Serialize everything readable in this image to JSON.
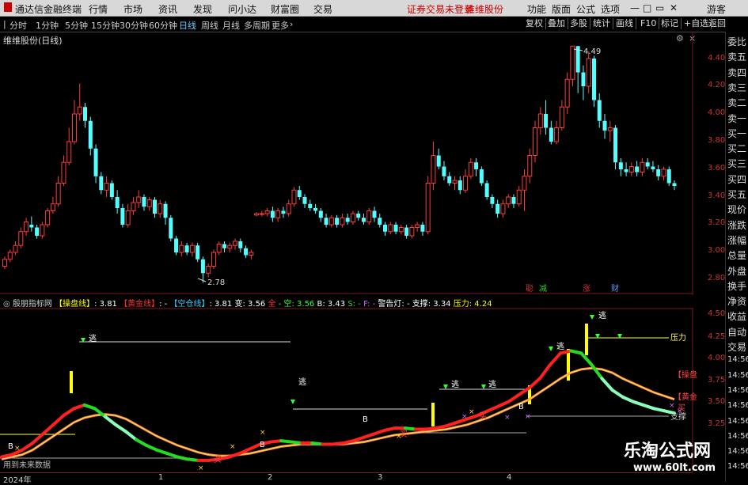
{
  "app": {
    "title": "通达信金融终端"
  },
  "menu": {
    "items": [
      "行情",
      "市场",
      "资讯",
      "发现",
      "问小达",
      "财富圈",
      "交易"
    ],
    "notice": "证券交易未登录",
    "stock_name": "维维股份",
    "right": [
      "功能",
      "版面",
      "公式",
      "选项"
    ],
    "user": "游客"
  },
  "toolbar": {
    "periods": [
      "分时",
      "1分钟",
      "5分钟",
      "15分钟",
      "30分钟",
      "60分钟",
      "日线",
      "周线",
      "月线",
      "多周期",
      "更多"
    ],
    "active_period": "日线",
    "buttons": [
      "复权",
      "叠加",
      "多股",
      "统计",
      "画线",
      "F10",
      "标记",
      "+自选",
      "返回"
    ]
  },
  "main_chart": {
    "title": "维维股份(日线)",
    "high_label": "4.49",
    "low_label": "2.78",
    "y_ticks": [
      "4.40",
      "4.20",
      "4.00",
      "3.80",
      "3.60",
      "3.40",
      "3.20",
      "3.00",
      "2.80"
    ],
    "event_tags": [
      {
        "text": "聪",
        "color": "#cc3333"
      },
      {
        "text": "减",
        "color": "#33cc33"
      },
      {
        "text": "涨",
        "color": "#cc3333"
      },
      {
        "text": "财",
        "color": "#6699ff"
      }
    ]
  },
  "indicator": {
    "name": "殷朋指标网",
    "legend": [
      {
        "label": "【操盘线】",
        "color": "#ffff00"
      },
      {
        "label": ": 3.81",
        "color": "#ffffff"
      },
      {
        "label": "【黄金线】",
        "color": "#ff3333"
      },
      {
        "label": ": -",
        "color": "#ffffff"
      },
      {
        "label": "【空仓线】",
        "color": "#33ccff"
      },
      {
        "label": ": 3.81",
        "color": "#ffffff"
      },
      {
        "label": "变: 3.56",
        "color": "#ffffff"
      },
      {
        "label": "全",
        "color": "#ff3333"
      },
      {
        "label": "- 空: 3.56",
        "color": "#33ff33"
      },
      {
        "label": "B: 3.43",
        "color": "#ffffff"
      },
      {
        "label": "S: -",
        "color": "#33cc33"
      },
      {
        "label": "F: -",
        "color": "#cc66ff"
      },
      {
        "label": "警告灯: -",
        "color": "#ffffff"
      },
      {
        "label": "支撑: 3.34",
        "color": "#ffffff"
      },
      {
        "label": "压力: 4.24",
        "color": "#ffff00"
      }
    ],
    "y_ticks": [
      "4.50",
      "4.25",
      "4.00",
      "3.75",
      "3.50",
      "3.25"
    ],
    "right_labels": [
      {
        "text": "压力",
        "color": "#ffff66"
      },
      {
        "text": "【操盘",
        "color": "#ff4444"
      },
      {
        "text": "【黄金",
        "color": "#ff4444"
      },
      {
        "text": "买",
        "color": "#ff4444"
      },
      {
        "text": "支撑",
        "color": "#cccccc"
      }
    ],
    "escape_label": "逃",
    "buy_label": "买",
    "b_label": "B",
    "footer_note": "用到未来数据"
  },
  "time_axis": {
    "labels": [
      "2024年",
      "1",
      "2",
      "3",
      "4"
    ]
  },
  "right_panel": {
    "items": [
      "委比",
      "卖五",
      "卖四",
      "卖三",
      "卖二",
      "卖一",
      "买一",
      "买二",
      "买三",
      "买四",
      "买五",
      "现价",
      "涨跌",
      "涨幅",
      "总量",
      "外盘",
      "换手",
      "净资",
      "收益",
      "自动",
      "交易",
      "14:56",
      "14:56",
      "14:56",
      "14:56",
      "14:56",
      "14:56",
      "14:56",
      "14:56"
    ]
  },
  "watermark": {
    "title": "乐淘公式网",
    "url": "www.60lt.com"
  },
  "chart_data": {
    "type": "candlestick",
    "ylim": [
      2.72,
      4.56
    ],
    "candles": [
      [
        2.9,
        2.95,
        2.88,
        2.97
      ],
      [
        2.95,
        3.0,
        2.93,
        3.02
      ],
      [
        3.0,
        3.05,
        2.98,
        3.08
      ],
      [
        3.05,
        3.15,
        3.03,
        3.18
      ],
      [
        3.15,
        3.22,
        3.12,
        3.25
      ],
      [
        3.2,
        3.18,
        3.15,
        3.26
      ],
      [
        3.18,
        3.12,
        3.1,
        3.2
      ],
      [
        3.12,
        3.2,
        3.1,
        3.22
      ],
      [
        3.2,
        3.3,
        3.18,
        3.32
      ],
      [
        3.3,
        3.35,
        3.28,
        3.4
      ],
      [
        3.35,
        3.5,
        3.33,
        3.55
      ],
      [
        3.5,
        3.65,
        3.48,
        3.7
      ],
      [
        3.65,
        3.8,
        3.63,
        3.9
      ],
      [
        3.8,
        4.0,
        3.78,
        4.1
      ],
      [
        4.0,
        4.05,
        3.95,
        4.22
      ],
      [
        4.05,
        3.95,
        3.9,
        4.08
      ],
      [
        3.95,
        3.75,
        3.7,
        3.98
      ],
      [
        3.75,
        3.55,
        3.5,
        3.78
      ],
      [
        3.55,
        3.45,
        3.42,
        3.58
      ],
      [
        3.45,
        3.5,
        3.4,
        3.55
      ],
      [
        3.5,
        3.4,
        3.38,
        3.52
      ],
      [
        3.4,
        3.32,
        3.28,
        3.45
      ],
      [
        3.32,
        3.2,
        3.18,
        3.35
      ],
      [
        3.2,
        3.3,
        3.18,
        3.35
      ],
      [
        3.3,
        3.36,
        3.27,
        3.4
      ],
      [
        3.36,
        3.4,
        3.32,
        3.45
      ],
      [
        3.4,
        3.33,
        3.3,
        3.42
      ],
      [
        3.33,
        3.38,
        3.3,
        3.4
      ],
      [
        3.38,
        3.28,
        3.25,
        3.4
      ],
      [
        3.28,
        3.35,
        3.25,
        3.38
      ],
      [
        3.35,
        3.25,
        3.2,
        3.37
      ],
      [
        3.25,
        3.1,
        3.08,
        3.27
      ],
      [
        3.1,
        3.0,
        2.98,
        3.12
      ],
      [
        3.0,
        3.05,
        2.97,
        3.08
      ],
      [
        3.05,
        3.0,
        2.98,
        3.07
      ],
      [
        3.0,
        3.05,
        2.97,
        3.07
      ],
      [
        3.05,
        2.95,
        2.93,
        3.07
      ],
      [
        2.95,
        2.85,
        2.78,
        2.97
      ],
      [
        2.85,
        2.9,
        2.82,
        2.92
      ],
      [
        2.9,
        3.0,
        2.88,
        3.02
      ],
      [
        3.0,
        3.06,
        2.98,
        3.08
      ],
      [
        3.06,
        3.03,
        3.0,
        3.08
      ],
      [
        3.03,
        3.05,
        3.0,
        3.07
      ],
      [
        3.05,
        3.08,
        3.02,
        3.1
      ],
      [
        3.08,
        3.03,
        3.0,
        3.1
      ],
      [
        3.03,
        2.98,
        2.96,
        3.05
      ],
      [
        2.98,
        3.0,
        2.95,
        3.02
      ],
      [
        3.27,
        3.28,
        3.26,
        3.29
      ],
      [
        3.28,
        3.28,
        3.26,
        3.3
      ],
      [
        3.28,
        3.3,
        3.26,
        3.32
      ],
      [
        3.3,
        3.25,
        3.22,
        3.33
      ],
      [
        3.25,
        3.3,
        3.22,
        3.32
      ],
      [
        3.3,
        3.28,
        3.25,
        3.33
      ],
      [
        3.28,
        3.35,
        3.26,
        3.38
      ],
      [
        3.35,
        3.45,
        3.33,
        3.47
      ],
      [
        3.45,
        3.4,
        3.38,
        3.48
      ],
      [
        3.4,
        3.35,
        3.32,
        3.42
      ],
      [
        3.35,
        3.32,
        3.3,
        3.38
      ],
      [
        3.32,
        3.3,
        3.28,
        3.35
      ],
      [
        3.3,
        3.25,
        3.22,
        3.32
      ],
      [
        3.25,
        3.2,
        3.18,
        3.28
      ],
      [
        3.2,
        3.25,
        3.18,
        3.27
      ],
      [
        3.25,
        3.2,
        3.18,
        3.27
      ],
      [
        3.2,
        3.25,
        3.18,
        3.28
      ],
      [
        3.25,
        3.22,
        3.2,
        3.28
      ],
      [
        3.22,
        3.28,
        3.2,
        3.3
      ],
      [
        3.28,
        3.25,
        3.23,
        3.3
      ],
      [
        3.25,
        3.22,
        3.2,
        3.28
      ],
      [
        3.22,
        3.3,
        3.2,
        3.32
      ],
      [
        3.3,
        3.25,
        3.22,
        3.33
      ],
      [
        3.25,
        3.2,
        3.18,
        3.28
      ],
      [
        3.2,
        3.15,
        3.12,
        3.22
      ],
      [
        3.15,
        3.2,
        3.13,
        3.22
      ],
      [
        3.2,
        3.15,
        3.13,
        3.22
      ],
      [
        3.15,
        3.18,
        3.13,
        3.2
      ],
      [
        3.18,
        3.12,
        3.1,
        3.2
      ],
      [
        3.12,
        3.18,
        3.1,
        3.2
      ],
      [
        3.18,
        3.2,
        3.15,
        3.22
      ],
      [
        3.2,
        3.15,
        3.12,
        3.22
      ],
      [
        3.15,
        3.5,
        3.13,
        3.55
      ],
      [
        3.5,
        3.7,
        3.45,
        3.8
      ],
      [
        3.7,
        3.62,
        3.6,
        3.75
      ],
      [
        3.62,
        3.55,
        3.52,
        3.66
      ],
      [
        3.55,
        3.5,
        3.48,
        3.58
      ],
      [
        3.5,
        3.52,
        3.45,
        3.55
      ],
      [
        3.52,
        3.45,
        3.42,
        3.55
      ],
      [
        3.45,
        3.55,
        3.43,
        3.6
      ],
      [
        3.55,
        3.65,
        3.53,
        3.68
      ],
      [
        3.65,
        3.6,
        3.55,
        3.68
      ],
      [
        3.6,
        3.5,
        3.48,
        3.62
      ],
      [
        3.5,
        3.4,
        3.38,
        3.52
      ],
      [
        3.4,
        3.35,
        3.32,
        3.42
      ],
      [
        3.35,
        3.28,
        3.25,
        3.38
      ],
      [
        3.28,
        3.35,
        3.25,
        3.38
      ],
      [
        3.35,
        3.4,
        3.32,
        3.42
      ],
      [
        3.4,
        3.35,
        3.32,
        3.42
      ],
      [
        3.35,
        3.45,
        3.33,
        3.48
      ],
      [
        3.45,
        3.55,
        3.3,
        3.6
      ],
      [
        3.55,
        3.7,
        3.5,
        3.75
      ],
      [
        3.7,
        3.9,
        3.65,
        3.95
      ],
      [
        3.9,
        4.0,
        3.85,
        4.05
      ],
      [
        4.0,
        3.9,
        3.85,
        4.1
      ],
      [
        3.9,
        3.8,
        3.78,
        3.95
      ],
      [
        3.8,
        3.9,
        3.78,
        3.95
      ],
      [
        3.9,
        4.05,
        3.88,
        4.1
      ],
      [
        4.05,
        4.25,
        4.0,
        4.3
      ],
      [
        4.25,
        4.49,
        4.2,
        4.49
      ],
      [
        4.49,
        4.3,
        4.15,
        4.49
      ],
      [
        4.3,
        4.2,
        4.1,
        4.35
      ],
      [
        4.2,
        4.4,
        4.15,
        4.45
      ],
      [
        4.4,
        4.1,
        4.05,
        4.42
      ],
      [
        4.1,
        3.95,
        3.9,
        4.15
      ],
      [
        3.95,
        3.88,
        3.82,
        4.0
      ],
      [
        3.88,
        3.9,
        3.8,
        3.95
      ],
      [
        3.9,
        3.65,
        3.6,
        3.92
      ],
      [
        3.65,
        3.6,
        3.55,
        3.68
      ],
      [
        3.6,
        3.58,
        3.55,
        3.65
      ],
      [
        3.58,
        3.62,
        3.55,
        3.65
      ],
      [
        3.62,
        3.58,
        3.55,
        3.66
      ],
      [
        3.58,
        3.65,
        3.55,
        3.68
      ],
      [
        3.65,
        3.62,
        3.6,
        3.68
      ],
      [
        3.62,
        3.6,
        3.58,
        3.66
      ],
      [
        3.6,
        3.55,
        3.52,
        3.63
      ],
      [
        3.55,
        3.6,
        3.52,
        3.62
      ],
      [
        3.6,
        3.5,
        3.48,
        3.62
      ],
      [
        3.5,
        3.48,
        3.45,
        3.52
      ]
    ],
    "indicator_lines": {
      "trade_line": [
        3.3,
        3.32,
        3.36,
        3.42,
        3.5,
        3.58,
        3.66,
        3.72,
        3.75,
        3.72,
        3.65,
        3.58,
        3.52,
        3.45,
        3.4,
        3.36,
        3.33,
        3.3,
        3.28,
        3.27,
        3.27,
        3.28,
        3.3,
        3.33,
        3.37,
        3.41,
        3.43,
        3.44,
        3.43,
        3.42,
        3.42,
        3.41,
        3.41,
        3.42,
        3.44,
        3.47,
        3.5,
        3.53,
        3.55,
        3.55,
        3.54,
        3.54,
        3.55,
        3.57,
        3.6,
        3.63,
        3.66,
        3.7,
        3.74,
        3.78,
        3.84,
        3.9,
        3.98,
        4.1,
        4.2,
        4.22,
        4.2,
        4.1,
        3.98,
        3.88,
        3.82,
        3.78,
        3.75,
        3.72,
        3.7,
        3.68
      ],
      "gold_line": [
        3.28,
        3.3,
        3.32,
        3.36,
        3.42,
        3.48,
        3.54,
        3.6,
        3.64,
        3.66,
        3.67,
        3.66,
        3.63,
        3.58,
        3.53,
        3.48,
        3.44,
        3.4,
        3.37,
        3.34,
        3.32,
        3.31,
        3.31,
        3.32,
        3.33,
        3.35,
        3.37,
        3.39,
        3.4,
        3.41,
        3.41,
        3.41,
        3.41,
        3.41,
        3.42,
        3.43,
        3.45,
        3.47,
        3.49,
        3.5,
        3.51,
        3.52,
        3.53,
        3.54,
        3.56,
        3.58,
        3.61,
        3.64,
        3.68,
        3.72,
        3.76,
        3.8,
        3.86,
        3.92,
        3.98,
        4.03,
        4.06,
        4.07,
        4.06,
        4.03,
        3.98,
        3.94,
        3.9,
        3.86,
        3.83,
        3.8
      ],
      "support": 3.34,
      "pressure": 4.24
    }
  }
}
